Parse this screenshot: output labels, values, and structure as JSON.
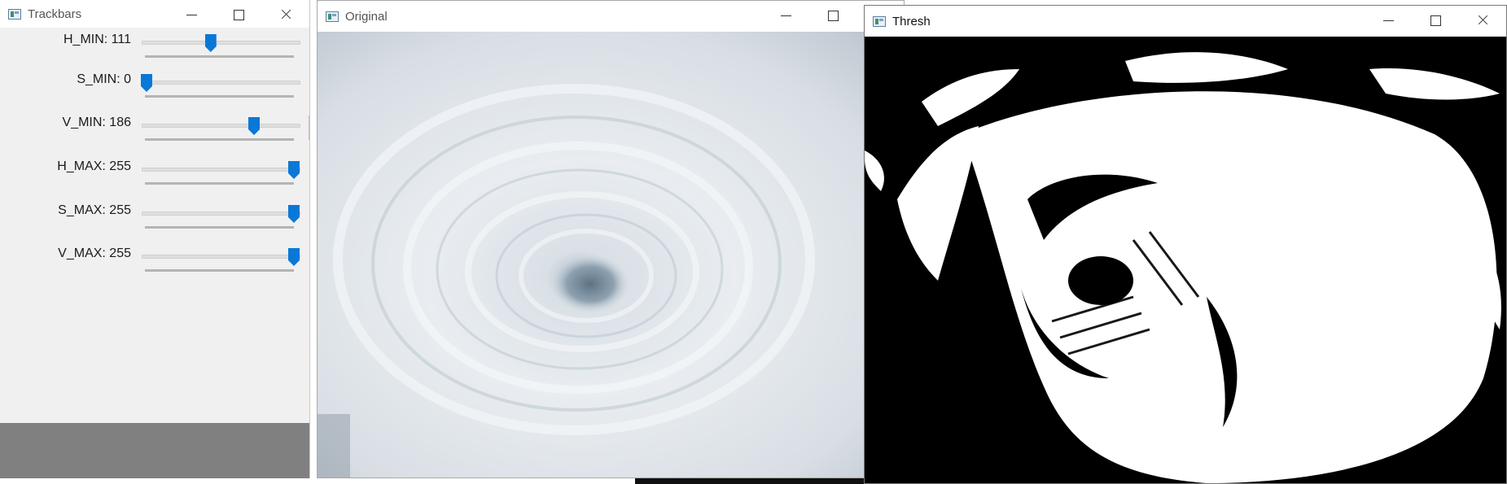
{
  "trackbars_window": {
    "title": "Trackbars",
    "sliders": [
      {
        "label": "H_MIN: 111",
        "value": 111,
        "max": 255
      },
      {
        "label": "S_MIN: 0",
        "value": 0,
        "max": 255
      },
      {
        "label": "V_MIN: 186",
        "value": 186,
        "max": 255
      },
      {
        "label": "H_MAX: 255",
        "value": 255,
        "max": 255
      },
      {
        "label": "S_MAX: 255",
        "value": 255,
        "max": 255
      },
      {
        "label": "V_MAX: 255",
        "value": 255,
        "max": 255
      }
    ]
  },
  "original_window": {
    "title": "Original"
  },
  "thresh_window": {
    "title": "Thresh"
  },
  "colors": {
    "slider_thumb": "#0a78d7",
    "panel_bg": "#f0f0f0",
    "threshold_fg": "#ffffff",
    "threshold_bg": "#000000"
  },
  "icons": [
    "app-window-icon",
    "minimize-icon",
    "maximize-icon",
    "close-icon"
  ]
}
